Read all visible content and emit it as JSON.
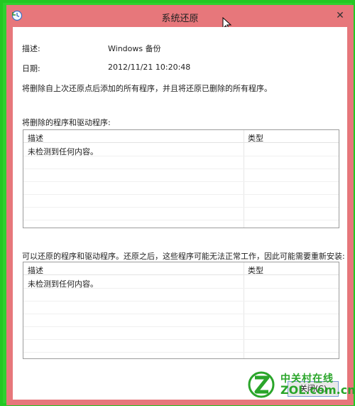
{
  "window": {
    "title": "系统还原",
    "close_glyph": "✕",
    "title_color": "#e7777b",
    "frame_color": "#2fd02f"
  },
  "info": {
    "desc_label": "描述:",
    "desc_value": "Windows 备份",
    "date_label": "日期:",
    "date_value": "2012/11/21 10:20:48",
    "warning": "将删除自上次还原点后添加的所有程序，并且将还原已删除的所有程序。"
  },
  "section1": {
    "label": "将删除的程序和驱动程序:",
    "columns": [
      "描述",
      "类型"
    ],
    "rows": [
      [
        "未检测到任何内容。",
        ""
      ]
    ]
  },
  "section2": {
    "label": "可以还原的程序和驱动程序。还原之后，这些程序可能无法正常工作，因此可能需要重新安装:",
    "columns": [
      "描述",
      "类型"
    ],
    "rows": [
      [
        "未检测到任何内容。",
        ""
      ]
    ]
  },
  "footer": {
    "close_label": "关闭(C)"
  },
  "watermark": {
    "cn": "中关村在线",
    "en": "ZOL.com.cn",
    "logo_letter": "Z"
  }
}
